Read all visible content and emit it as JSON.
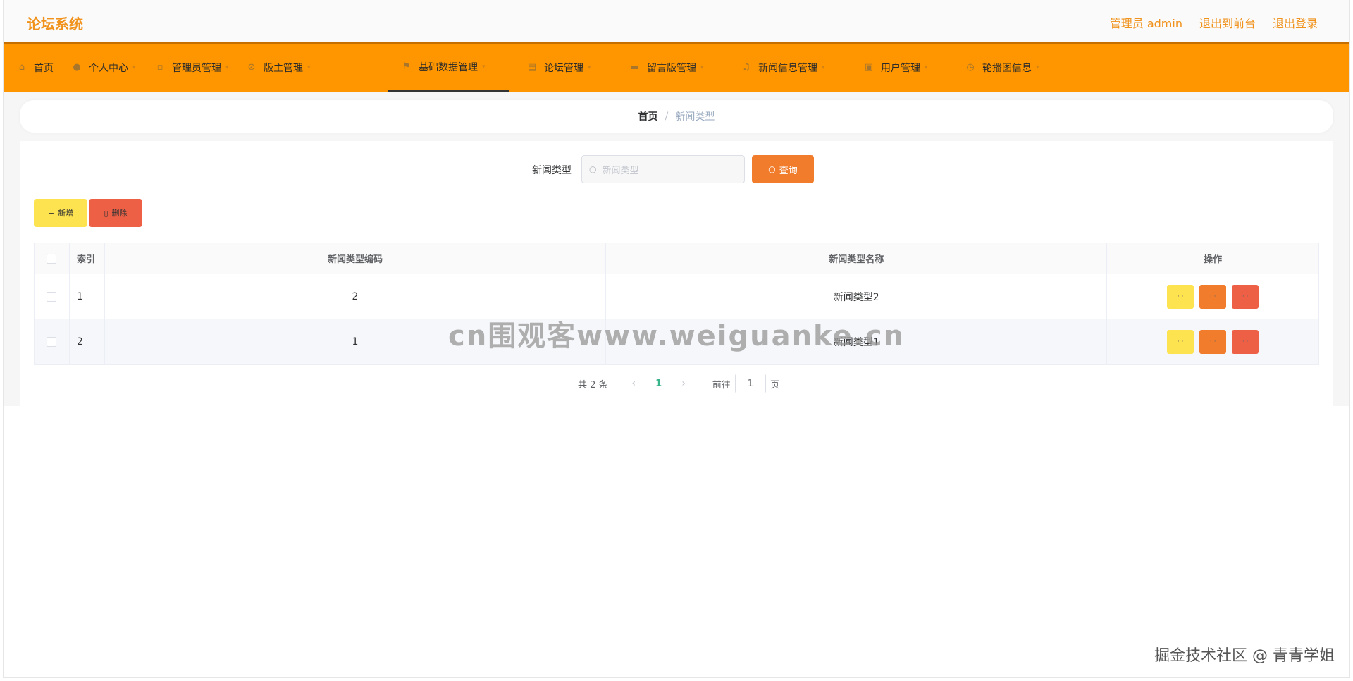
{
  "header": {
    "title": "论坛系统",
    "links": [
      "管理员 admin",
      "退出到前台",
      "退出登录"
    ]
  },
  "nav": {
    "items": [
      {
        "label": "首页",
        "icon": "home-icon"
      },
      {
        "label": "个人中心",
        "icon": "user-icon"
      },
      {
        "label": "管理员管理",
        "icon": "document-icon"
      },
      {
        "label": "版主管理",
        "icon": "slash-circle-icon"
      },
      {
        "label": "基础数据管理",
        "icon": "flag-icon",
        "active": true
      },
      {
        "label": "论坛管理",
        "icon": "clipboard-icon"
      },
      {
        "label": "留言版管理",
        "icon": "message-icon"
      },
      {
        "label": "新闻信息管理",
        "icon": "microphone-icon"
      },
      {
        "label": "用户管理",
        "icon": "users-icon"
      },
      {
        "label": "轮播图信息",
        "icon": "clock-icon"
      }
    ]
  },
  "breadcrumb": {
    "home": "首页",
    "separator": "/",
    "current": "新闻类型"
  },
  "search": {
    "label": "新闻类型",
    "placeholder": "新闻类型",
    "button": "查询"
  },
  "actions": {
    "add": "新增",
    "delete": "删除"
  },
  "table": {
    "headers": [
      "索引",
      "新闻类型编码",
      "新闻类型名称",
      "操作"
    ],
    "rows": [
      {
        "index": "1",
        "code": "2",
        "name": "新闻类型2"
      },
      {
        "index": "2",
        "code": "1",
        "name": "新闻类型1"
      }
    ]
  },
  "pagination": {
    "total": "共 2 条",
    "current_page": "1",
    "goto_label": "前往",
    "goto_value": "1",
    "page_suffix": "页"
  },
  "watermarks": {
    "center": "cn围观客www.weiguanke.cn",
    "corner": "掘金技术社区 @ 青青学姐"
  },
  "colors": {
    "brand": "#ff9600",
    "title": "#f0921c",
    "query": "#f07c2c",
    "add": "#fde34f",
    "delete": "#ee6045",
    "page_active": "#38b48b"
  }
}
